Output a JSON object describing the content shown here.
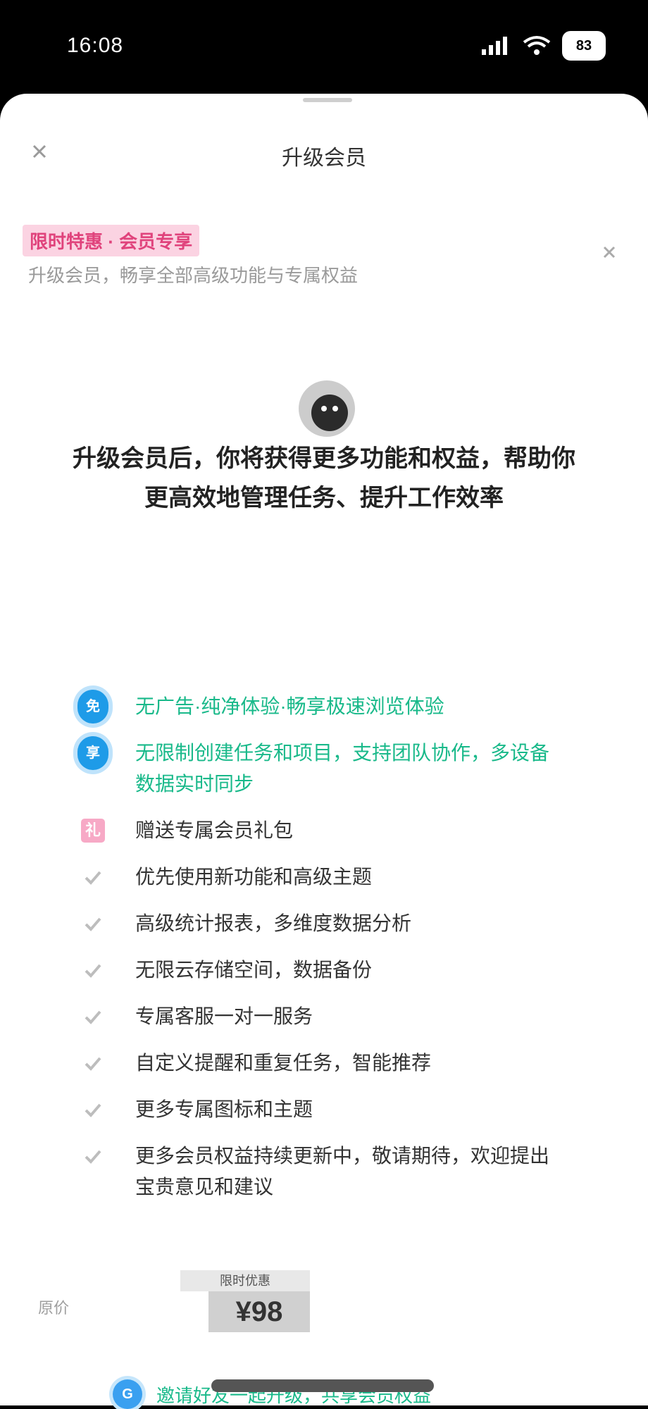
{
  "status_bar": {
    "time": "16:08",
    "battery": "83"
  },
  "nav": {
    "title": "升级会员",
    "close_icon": "close-icon"
  },
  "promo": {
    "tag": "限时特惠 · 会员专享",
    "subtitle": "升级会员，畅享全部高级功能与专属权益",
    "close_icon": "close-icon"
  },
  "heading": {
    "icon": "face-icon",
    "text": "升级会员后，你将获得更多功能和权益，帮助你更高效地管理任务、提升工作效率"
  },
  "features": [
    {
      "bullet": "bubble",
      "bullet_text": "免",
      "text": "无广告·纯净体验·畅享极速浏览体验",
      "highlight": true
    },
    {
      "bullet": "bubble",
      "bullet_text": "享",
      "text": "无限制创建任务和项目，支持团队协作，多设备数据实时同步",
      "highlight": true
    },
    {
      "bullet": "gift",
      "bullet_text": "礼",
      "text": "赠送专属会员礼包",
      "highlight": false
    },
    {
      "bullet": "check",
      "text": "优先使用新功能和高级主题",
      "highlight": false
    },
    {
      "bullet": "check",
      "text": "高级统计报表，多维度数据分析",
      "highlight": false
    },
    {
      "bullet": "check",
      "text": "无限云存储空间，数据备份",
      "highlight": false
    },
    {
      "bullet": "check",
      "text": "专属客服一对一服务",
      "highlight": false
    },
    {
      "bullet": "check",
      "text": "自定义提醒和重复任务，智能推荐",
      "highlight": false
    },
    {
      "bullet": "check",
      "text": "更多专属图标和主题",
      "highlight": false
    },
    {
      "bullet": "check",
      "text": "更多会员权益持续更新中，敬请期待，欢迎提出宝贵意见和建议",
      "highlight": false
    }
  ],
  "pricing": {
    "old_price": "原价",
    "badge": "限时优惠",
    "new_price": "¥98"
  },
  "bottom_link": {
    "icon": "gift-icon",
    "icon_text": "G",
    "text": "邀请好友一起升级，共享会员权益"
  },
  "colors": {
    "accent_green": "#19b98a",
    "accent_blue": "#1e9be8",
    "tag_pink": "#e0437c"
  }
}
